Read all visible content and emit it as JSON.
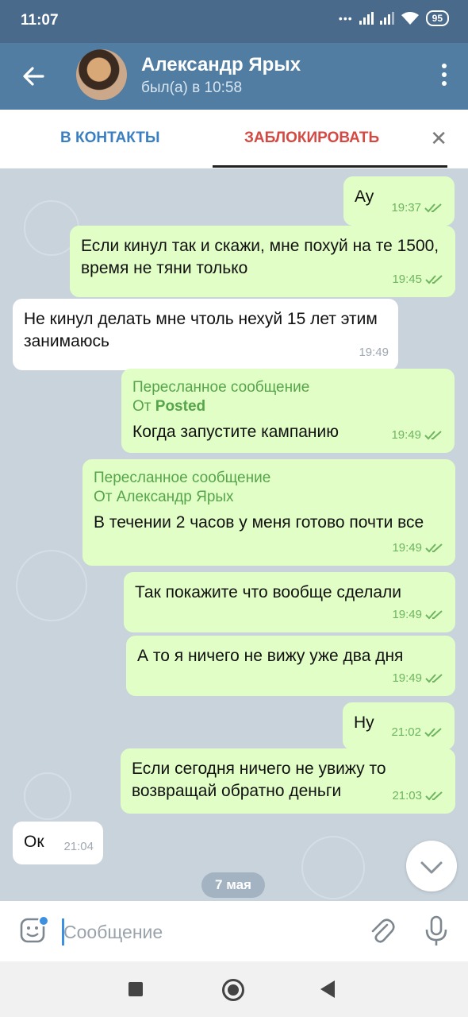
{
  "status_bar": {
    "time": "11:07",
    "battery": "95"
  },
  "header": {
    "name": "Александр Ярых",
    "status": "был(а) в 10:58"
  },
  "action_bar": {
    "add_contact": "В КОНТАКТЫ",
    "block": "ЗАБЛОКИРОВАТЬ",
    "close": "✕"
  },
  "messages": [
    {
      "dir": "out",
      "text": "Ау",
      "time": "19:37"
    },
    {
      "dir": "out",
      "text": "Если кинул так и скажи, мне похуй на те 1500, время не тяни только",
      "time": "19:45"
    },
    {
      "dir": "in",
      "text": "Не кинул делать мне чтоль нехуй 15 лет этим занимаюсь",
      "time": "19:49"
    },
    {
      "dir": "out",
      "forward_label": "Пересланное сообщение",
      "forward_prefix": "От",
      "forward_from": "Posted",
      "text": "Когда запустите кампанию",
      "time": "19:49"
    },
    {
      "dir": "out",
      "forward_label": "Пересланное сообщение",
      "forward_from_line": "От Александр Ярых",
      "text": "В течении 2 часов у меня готово почти все",
      "time": "19:49"
    },
    {
      "dir": "out",
      "text": "Так покажите что вообще сделали",
      "time": "19:49"
    },
    {
      "dir": "out",
      "text": "А то я ничего не вижу уже два дня",
      "time": "19:49"
    },
    {
      "dir": "out",
      "text": "Ну",
      "time": "21:02"
    },
    {
      "dir": "out",
      "text": "Если сегодня ничего не увижу то возвращай обратно деньги",
      "time": "21:03"
    },
    {
      "dir": "in",
      "text": "Ок",
      "time": "21:04"
    }
  ],
  "date_pill": "7 мая",
  "composer": {
    "placeholder": "Сообщение"
  },
  "colors": {
    "header": "#517da2",
    "outgoing_bubble": "#e1fec6",
    "block_red": "#d24a43",
    "link_blue": "#3a7fc1"
  }
}
